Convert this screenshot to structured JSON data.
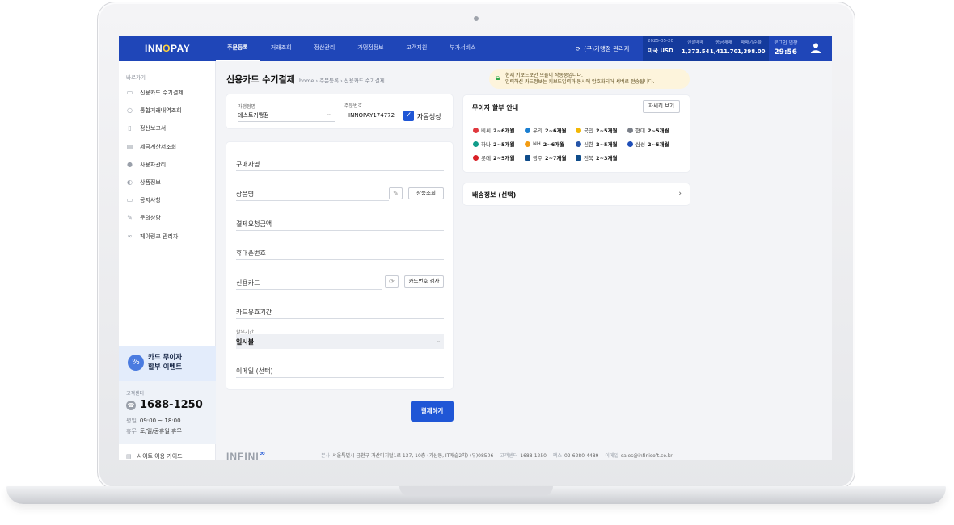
{
  "topbar": {
    "logo_pre": "INN",
    "logo_o": "O",
    "logo_post": "PAY",
    "nav": [
      "주문등록",
      "거래조회",
      "정산관리",
      "가맹점정보",
      "고객지원",
      "부가서비스"
    ],
    "merchant": "(구)가맹점 관리자",
    "rates": [
      {
        "label": "2025-05-20",
        "value": "미국 USD"
      },
      {
        "label": "현찰매매",
        "value": "1,373.54"
      },
      {
        "label": "송금매매",
        "value": "1,411.70"
      },
      {
        "label": "매매기준율",
        "value": "1,398.00"
      }
    ],
    "login_ext_label": "로그인 연장",
    "login_ext_value": "29:56"
  },
  "sidebar": {
    "title": "바로가기",
    "items": [
      {
        "label": "신용카드 수기결제",
        "icon": "credit-card-icon"
      },
      {
        "label": "통합거래내역조회",
        "icon": "search-icon"
      },
      {
        "label": "정산보고서",
        "icon": "report-icon"
      },
      {
        "label": "세금계산서조회",
        "icon": "document-icon"
      },
      {
        "label": "사용자관리",
        "icon": "user-icon"
      },
      {
        "label": "상품정보",
        "icon": "tag-icon"
      },
      {
        "label": "공지사항",
        "icon": "notice-icon"
      },
      {
        "label": "문의상담",
        "icon": "pencil-icon"
      },
      {
        "label": "페이링크 관리자",
        "icon": "link-icon"
      }
    ],
    "event_line1": "카드 무이자",
    "event_line2": "할부 이벤트",
    "cs_label": "고객센터",
    "cs_phone": "1688-1250",
    "cs_weekday_k": "평일",
    "cs_weekday_v": "09:00 ~ 18:00",
    "cs_holiday_k": "휴무",
    "cs_holiday_v": "토/일/공휴일 휴무",
    "guide": "사이트 이용 가이드"
  },
  "page": {
    "title": "신용카드 수기결제",
    "breadcrumb": "home  ›  주문등록  ›  신용카드 수기결제",
    "notice_line1": "현재 키보드보안 모듈이 작동중입니다.",
    "notice_line2": "입력하신 카드정보는 키보드입력과 동시에 암호화되어 서버로 전송됩니다."
  },
  "order": {
    "merchant_label": "가맹점명",
    "merchant_value": "테스트가맹점",
    "order_no_label": "주문번호",
    "order_no_value": "INNOPAY174772",
    "auto_label": "자동생성"
  },
  "form": {
    "buyer": "구매자명",
    "product": "상품명",
    "product_btn": "상품조회",
    "amount": "결제요청금액",
    "phone": "휴대폰번호",
    "card": "신용카드",
    "card_btn": "카드번호 검사",
    "expiry": "카드유효기간",
    "installment_label": "할부기간",
    "installment_value": "일시불",
    "email": "이메일 (선택)",
    "pay_btn": "결제하기"
  },
  "installment_info": {
    "title": "무이자 할부 안내",
    "detail_btn": "자세히 보기",
    "banks": [
      {
        "name": "비씨",
        "months": "2~6개월",
        "color": "#e0383e"
      },
      {
        "name": "우리",
        "months": "2~6개월",
        "color": "#1b7fd1"
      },
      {
        "name": "국민",
        "months": "2~5개월",
        "color": "#f2b705"
      },
      {
        "name": "현대",
        "months": "2~5개월",
        "color": "#7a7f88"
      },
      {
        "name": "하나",
        "months": "2~5개월",
        "color": "#119c8a"
      },
      {
        "name": "NH",
        "months": "2~6개월",
        "color": "#f39c12"
      },
      {
        "name": "신한",
        "months": "2~5개월",
        "color": "#2655a8"
      },
      {
        "name": "삼성",
        "months": "2~5개월",
        "color": "#1f4fb8"
      },
      {
        "name": "롯데",
        "months": "2~5개월",
        "color": "#d92027"
      },
      {
        "name": "광주",
        "months": "2~7개월",
        "color": "#0f4c8a"
      },
      {
        "name": "전북",
        "months": "2~3개월",
        "color": "#0f4c8a"
      }
    ]
  },
  "shipping": {
    "title": "배송정보 (선택)"
  },
  "footer": {
    "logo_text": "INFINI",
    "addr_k": "본사",
    "addr_v": "서울특별시 금천구 가산디지털1로 137, 10층 (가산동, IT캐슬2차) (우)08506",
    "cs_k": "고객센터",
    "cs_v": "1688-1250",
    "fax_k": "팩스",
    "fax_v": "02-6280-4489",
    "mail_k": "이메일",
    "mail_v": "sales@infinisoft.co.kr"
  }
}
